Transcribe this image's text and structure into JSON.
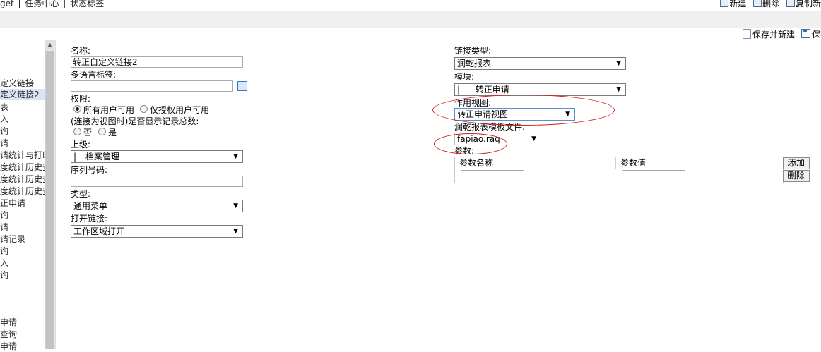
{
  "topbar": {
    "crumbs": [
      "get",
      "|",
      "任务中心",
      "|",
      "状态标签"
    ],
    "actions": {
      "new": "新建",
      "delete": "删除",
      "copy": "复制新"
    }
  },
  "actionbar": {
    "save_new": "保存并新建",
    "save": "保存"
  },
  "tree": [
    "定义链接",
    "定义链接2",
    "表",
    "入",
    "询",
    "请",
    "请统计与打印",
    "度统计历史查",
    "度统计历史查",
    "度统计历史查",
    "正申请",
    "询",
    "请",
    "请记录",
    "询",
    "入",
    "询",
    "申请",
    "查询",
    "申请"
  ],
  "form": {
    "name_label": "名称:",
    "name_value": "转正自定义链接2",
    "i18n_label": "多语言标签:",
    "i18n_value": "",
    "permission_label": "权限:",
    "perm_all": "所有用户可用",
    "perm_auth": "仅授权用户可用",
    "count_label": "(连接为视图时)是否显示记录总数:",
    "no": "否",
    "yes": "是",
    "parent_label": "上级:",
    "parent_value": "|---档案管理",
    "seq_label": "序列号码:",
    "seq_value": "",
    "type_label": "类型:",
    "type_value": "通用菜单",
    "open_label": "打开链接:",
    "open_value": "工作区域打开"
  },
  "right": {
    "link_type_label": "链接类型:",
    "link_type_value": "润乾报表",
    "module_label": "模块:",
    "module_value": "|-----转正申请",
    "view_label": "作用视图:",
    "view_value": "转正申请视图",
    "template_label": "润乾报表模板文件:",
    "template_value": "fapiao.raq",
    "params_label": "参数:",
    "col_name": "参数名称",
    "col_value": "参数值",
    "add": "添加",
    "delete": "删除"
  },
  "colors": {
    "highlight": "#d62020",
    "selected_bg": "#dbe4f5"
  }
}
